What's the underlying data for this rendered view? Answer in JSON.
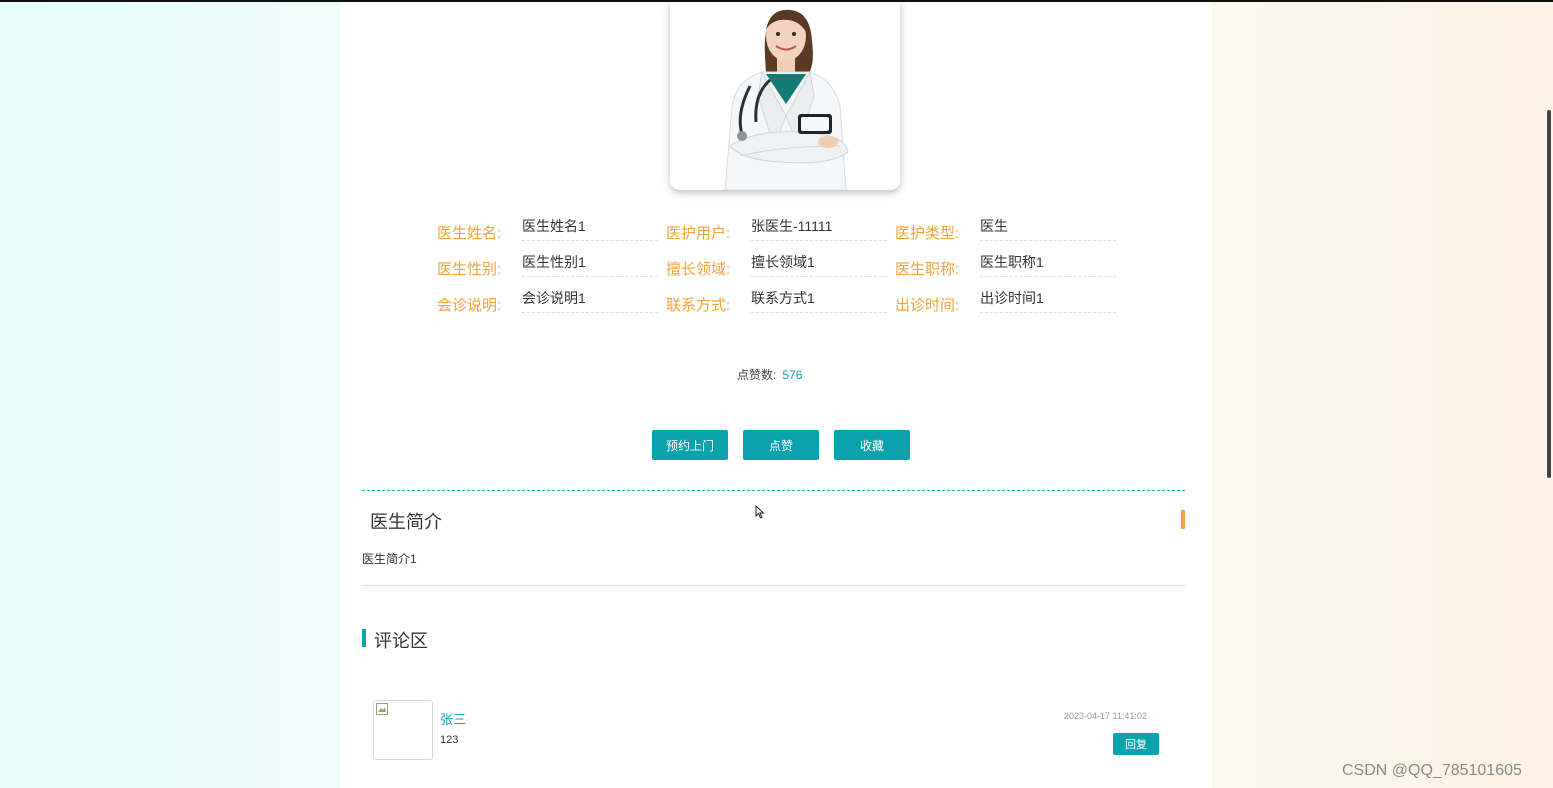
{
  "doctor": {
    "fields": [
      [
        {
          "label": "医生姓名:",
          "value": "医生姓名1"
        },
        {
          "label": "医护用户:",
          "value": "张医生-11111"
        },
        {
          "label": "医护类型:",
          "value": "医生"
        }
      ],
      [
        {
          "label": "医生性别:",
          "value": "医生性别1"
        },
        {
          "label": "擅长领域:",
          "value": "擅长领域1"
        },
        {
          "label": "医生职称:",
          "value": "医生职称1"
        }
      ],
      [
        {
          "label": "会诊说明:",
          "value": "会诊说明1"
        },
        {
          "label": "联系方式:",
          "value": "联系方式1"
        },
        {
          "label": "出诊时间:",
          "value": "出诊时间1"
        }
      ]
    ]
  },
  "likes": {
    "label": "点赞数:",
    "count": "576"
  },
  "actions": {
    "book": "预约上门",
    "like": "点赞",
    "favorite": "收藏"
  },
  "intro": {
    "title": "医生简介",
    "text": "医生简介1"
  },
  "comments": {
    "title": "评论区",
    "items": [
      {
        "user": "张三",
        "text": "123",
        "time": "2023-04-17 11:41:02",
        "reply_label": "回复"
      }
    ]
  },
  "watermark": "CSDN @QQ_785101605",
  "colors": {
    "accent": "#0aa3ad",
    "label_orange": "#f3a13a"
  }
}
